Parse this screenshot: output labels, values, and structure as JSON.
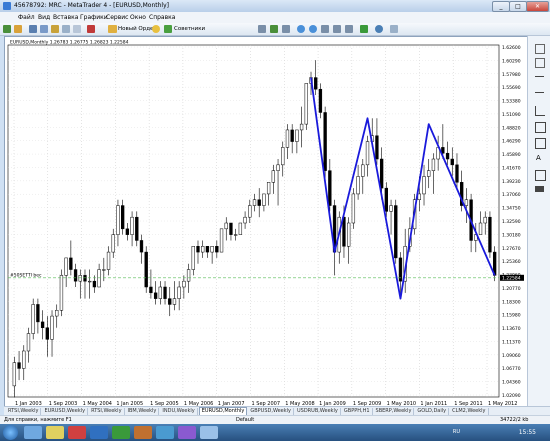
{
  "window": {
    "title": "45678792: MRC - MetaTrader 4 - [EURUSD,Monthly]",
    "btn_min": "_",
    "btn_max": "□",
    "btn_close": "✕"
  },
  "menu": {
    "items": [
      "Файл",
      "Вид",
      "Вставка",
      "Графики",
      "Сервис",
      "Окно",
      "Справка"
    ]
  },
  "toolbar": {
    "new_order_label": "Новый Ордер",
    "advisors_label": "Советники"
  },
  "chart": {
    "header_info": "EURUSD,Monthly  1.26783 1.26775 1.26823 1.22584",
    "bid_line_label": "#50SETTI  bec",
    "last_price_label": "1.22584",
    "y_ticks": [
      "1.62600",
      "1.60290",
      "1.57980",
      "1.55690",
      "1.53380",
      "1.51090",
      "1.48820",
      "1.46290",
      "1.45890",
      "1.41670",
      "1.39230",
      "1.37060",
      "1.34750",
      "1.32590",
      "1.30180",
      "1.27670",
      "1.25360",
      "1.23060",
      "1.20770",
      "1.18300",
      "1.15980",
      "1.13670",
      "1.11370",
      "1.09060",
      "1.06770",
      "1.04360",
      "1.02090"
    ],
    "x_ticks": [
      "1 Jan 2003",
      "1 Sep 2003",
      "1 May 2004",
      "1 Jan 2005",
      "1 Sep 2005",
      "1 May 2006",
      "1 Jan 2007",
      "1 Sep 2007",
      "1 May 2008",
      "1 Jan 2009",
      "1 Sep 2009",
      "1 May 2010",
      "1 Jan 2011",
      "1 Sep 2011",
      "1 May 2012"
    ]
  },
  "chart_data": {
    "type": "candlestick",
    "title": "EURUSD,Monthly",
    "ylim": [
      1.0209,
      1.626
    ],
    "zigzag_color": "#1a1adb",
    "bid_line_color": "#55bb55",
    "candles": [
      [
        1.04,
        1.09,
        1.02,
        1.08
      ],
      [
        1.08,
        1.1,
        1.05,
        1.07
      ],
      [
        1.07,
        1.11,
        1.05,
        1.1
      ],
      [
        1.1,
        1.14,
        1.08,
        1.13
      ],
      [
        1.13,
        1.19,
        1.12,
        1.18
      ],
      [
        1.18,
        1.19,
        1.13,
        1.15
      ],
      [
        1.15,
        1.17,
        1.12,
        1.14
      ],
      [
        1.14,
        1.16,
        1.09,
        1.12
      ],
      [
        1.12,
        1.17,
        1.09,
        1.16
      ],
      [
        1.16,
        1.18,
        1.14,
        1.17
      ],
      [
        1.17,
        1.24,
        1.16,
        1.23
      ],
      [
        1.23,
        1.26,
        1.21,
        1.26
      ],
      [
        1.26,
        1.29,
        1.23,
        1.24
      ],
      [
        1.24,
        1.25,
        1.21,
        1.22
      ],
      [
        1.22,
        1.24,
        1.19,
        1.23
      ],
      [
        1.23,
        1.24,
        1.19,
        1.22
      ],
      [
        1.22,
        1.24,
        1.19,
        1.22
      ],
      [
        1.22,
        1.23,
        1.2,
        1.21
      ],
      [
        1.21,
        1.25,
        1.21,
        1.24
      ],
      [
        1.24,
        1.26,
        1.22,
        1.24
      ],
      [
        1.24,
        1.28,
        1.23,
        1.27
      ],
      [
        1.27,
        1.31,
        1.26,
        1.3
      ],
      [
        1.3,
        1.36,
        1.28,
        1.35
      ],
      [
        1.35,
        1.36,
        1.3,
        1.31
      ],
      [
        1.31,
        1.32,
        1.29,
        1.3
      ],
      [
        1.3,
        1.34,
        1.28,
        1.33
      ],
      [
        1.33,
        1.34,
        1.28,
        1.29
      ],
      [
        1.29,
        1.3,
        1.25,
        1.27
      ],
      [
        1.27,
        1.28,
        1.2,
        1.21
      ],
      [
        1.21,
        1.24,
        1.19,
        1.2
      ],
      [
        1.2,
        1.22,
        1.18,
        1.19
      ],
      [
        1.19,
        1.22,
        1.18,
        1.21
      ],
      [
        1.21,
        1.22,
        1.18,
        1.19
      ],
      [
        1.19,
        1.21,
        1.16,
        1.18
      ],
      [
        1.18,
        1.22,
        1.17,
        1.19
      ],
      [
        1.19,
        1.22,
        1.17,
        1.21
      ],
      [
        1.21,
        1.23,
        1.19,
        1.22
      ],
      [
        1.22,
        1.25,
        1.2,
        1.24
      ],
      [
        1.24,
        1.28,
        1.23,
        1.28
      ],
      [
        1.28,
        1.29,
        1.25,
        1.27
      ],
      [
        1.27,
        1.29,
        1.26,
        1.28
      ],
      [
        1.28,
        1.28,
        1.26,
        1.27
      ],
      [
        1.27,
        1.28,
        1.25,
        1.28
      ],
      [
        1.28,
        1.29,
        1.26,
        1.27
      ],
      [
        1.27,
        1.31,
        1.27,
        1.31
      ],
      [
        1.31,
        1.33,
        1.29,
        1.32
      ],
      [
        1.32,
        1.32,
        1.29,
        1.3
      ],
      [
        1.3,
        1.31,
        1.29,
        1.3
      ],
      [
        1.3,
        1.32,
        1.3,
        1.32
      ],
      [
        1.32,
        1.34,
        1.31,
        1.33
      ],
      [
        1.33,
        1.36,
        1.32,
        1.35
      ],
      [
        1.35,
        1.37,
        1.34,
        1.36
      ],
      [
        1.36,
        1.38,
        1.33,
        1.35
      ],
      [
        1.35,
        1.37,
        1.34,
        1.37
      ],
      [
        1.37,
        1.39,
        1.35,
        1.39
      ],
      [
        1.39,
        1.42,
        1.37,
        1.41
      ],
      [
        1.41,
        1.43,
        1.35,
        1.42
      ],
      [
        1.42,
        1.46,
        1.4,
        1.45
      ],
      [
        1.45,
        1.49,
        1.43,
        1.48
      ],
      [
        1.48,
        1.49,
        1.44,
        1.46
      ],
      [
        1.46,
        1.48,
        1.44,
        1.48
      ],
      [
        1.48,
        1.52,
        1.45,
        1.49
      ],
      [
        1.49,
        1.56,
        1.48,
        1.56
      ],
      [
        1.56,
        1.58,
        1.54,
        1.57
      ],
      [
        1.57,
        1.6,
        1.54,
        1.55
      ],
      [
        1.55,
        1.56,
        1.5,
        1.51
      ],
      [
        1.51,
        1.52,
        1.39,
        1.41
      ],
      [
        1.41,
        1.43,
        1.34,
        1.35
      ],
      [
        1.35,
        1.36,
        1.23,
        1.27
      ],
      [
        1.27,
        1.34,
        1.25,
        1.33
      ],
      [
        1.33,
        1.35,
        1.26,
        1.28
      ],
      [
        1.28,
        1.33,
        1.25,
        1.32
      ],
      [
        1.32,
        1.38,
        1.31,
        1.37
      ],
      [
        1.37,
        1.42,
        1.36,
        1.4
      ],
      [
        1.4,
        1.43,
        1.37,
        1.42
      ],
      [
        1.42,
        1.47,
        1.4,
        1.46
      ],
      [
        1.46,
        1.5,
        1.45,
        1.47
      ],
      [
        1.47,
        1.5,
        1.42,
        1.43
      ],
      [
        1.43,
        1.45,
        1.36,
        1.38
      ],
      [
        1.38,
        1.39,
        1.33,
        1.34
      ],
      [
        1.34,
        1.36,
        1.3,
        1.35
      ],
      [
        1.35,
        1.36,
        1.25,
        1.26
      ],
      [
        1.26,
        1.27,
        1.19,
        1.22
      ],
      [
        1.22,
        1.31,
        1.2,
        1.28
      ],
      [
        1.28,
        1.33,
        1.27,
        1.31
      ],
      [
        1.31,
        1.37,
        1.3,
        1.36
      ],
      [
        1.36,
        1.4,
        1.34,
        1.37
      ],
      [
        1.37,
        1.42,
        1.35,
        1.4
      ],
      [
        1.4,
        1.43,
        1.38,
        1.41
      ],
      [
        1.41,
        1.44,
        1.37,
        1.43
      ],
      [
        1.43,
        1.47,
        1.41,
        1.45
      ],
      [
        1.45,
        1.49,
        1.43,
        1.44
      ],
      [
        1.44,
        1.46,
        1.42,
        1.43
      ],
      [
        1.43,
        1.45,
        1.4,
        1.42
      ],
      [
        1.42,
        1.44,
        1.38,
        1.39
      ],
      [
        1.39,
        1.41,
        1.34,
        1.35
      ],
      [
        1.35,
        1.38,
        1.32,
        1.36
      ],
      [
        1.36,
        1.37,
        1.27,
        1.29
      ],
      [
        1.29,
        1.32,
        1.27,
        1.3
      ],
      [
        1.3,
        1.34,
        1.3,
        1.32
      ],
      [
        1.32,
        1.34,
        1.3,
        1.33
      ],
      [
        1.33,
        1.34,
        1.26,
        1.27
      ],
      [
        1.27,
        1.28,
        1.22,
        1.23
      ]
    ],
    "zigzag": [
      [
        1.57,
        63
      ],
      [
        1.27,
        68
      ],
      [
        1.5,
        75
      ],
      [
        1.19,
        82
      ],
      [
        1.49,
        88
      ],
      [
        1.23,
        102
      ]
    ]
  },
  "tabs": [
    "RTSI,Weekly",
    "EURUSD,Weekly",
    "RTSI,Weekly",
    "IBM,Weekly",
    "INDU,Weekly",
    "EURUSD,Monthly",
    "GBPUSD,Weekly",
    "USDRUB,Weekly",
    "GBPPH,H1",
    "SBERP,Weekly",
    "GOLD,Daily",
    "CLM2,Weekly"
  ],
  "active_tab_index": 5,
  "status": {
    "help": "Для справки, нажмите F1",
    "profile": "Default",
    "traffic": "34722/2 kb"
  },
  "taskbar": {
    "lang": "RU",
    "clock": "15:55"
  }
}
